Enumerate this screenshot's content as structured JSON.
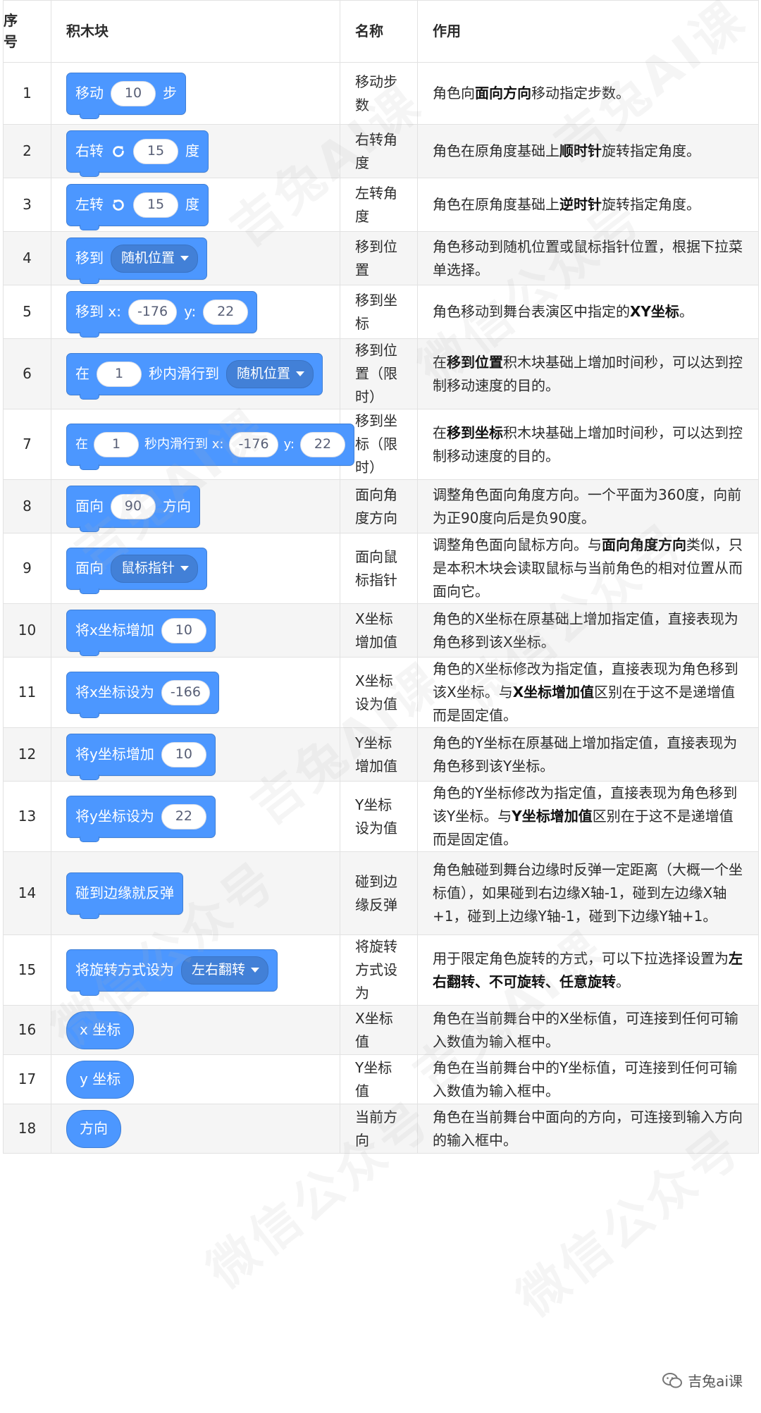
{
  "headers": {
    "index": "序号",
    "block": "积木块",
    "name": "名称",
    "desc": "作用"
  },
  "rows": [
    {
      "idx": "1",
      "block_parts": [
        "移动",
        "10",
        "步"
      ],
      "name": "移动步\n数",
      "desc": [
        {
          "t": "角色向"
        },
        {
          "t": "面向方向",
          "b": true
        },
        {
          "t": "移动指定步数。"
        }
      ]
    },
    {
      "idx": "2",
      "block_parts": [
        "右转",
        "15",
        "度"
      ],
      "name": "右转角\n度",
      "desc": [
        {
          "t": "角色在原角度基础上"
        },
        {
          "t": "顺时针",
          "b": true
        },
        {
          "t": "旋转指定角度。"
        }
      ]
    },
    {
      "idx": "3",
      "block_parts": [
        "左转",
        "15",
        "度"
      ],
      "name": "左转角\n度",
      "desc": [
        {
          "t": "角色在原角度基础上"
        },
        {
          "t": "逆时针",
          "b": true
        },
        {
          "t": "旋转指定角度。"
        }
      ]
    },
    {
      "idx": "4",
      "block_parts": [
        "移到",
        "随机位置"
      ],
      "name": "移到位\n置",
      "desc": [
        {
          "t": "角色移动到随机位置或鼠标指针位置，根据下拉菜单选择。"
        }
      ]
    },
    {
      "idx": "5",
      "block_parts": [
        "移到 x:",
        "-176",
        "y:",
        "22"
      ],
      "name": "移到坐\n标",
      "desc": [
        {
          "t": "角色移动到舞台表演区中指定的"
        },
        {
          "t": "XY坐标",
          "b": true
        },
        {
          "t": "。"
        }
      ]
    },
    {
      "idx": "6",
      "block_parts": [
        "在",
        "1",
        "秒内滑行到",
        "随机位置"
      ],
      "name": "移到位\n置（限\n时）",
      "desc": [
        {
          "t": "在"
        },
        {
          "t": "移到位置",
          "b": true
        },
        {
          "t": "积木块基础上增加时间秒，可以达到控制移动速度的目的。"
        }
      ]
    },
    {
      "idx": "7",
      "block_parts": [
        "在",
        "1",
        "秒内滑行到 x:",
        "-176",
        "y:",
        "22"
      ],
      "name": "移到坐\n标（限\n时）",
      "desc": [
        {
          "t": "在"
        },
        {
          "t": "移到坐标",
          "b": true
        },
        {
          "t": "积木块基础上增加时间秒，可以达到控制移动速度的目的。"
        }
      ]
    },
    {
      "idx": "8",
      "block_parts": [
        "面向",
        "90",
        "方向"
      ],
      "name": "面向角\n度方向",
      "desc": [
        {
          "t": "调整角色面向角度方向。一个平面为360度，向前为正90度向后是负90度。"
        }
      ]
    },
    {
      "idx": "9",
      "block_parts": [
        "面向",
        "鼠标指针"
      ],
      "name": "面向鼠\n标指针",
      "desc": [
        {
          "t": "调整角色面向鼠标方向。与"
        },
        {
          "t": "面向角度方向",
          "b": true
        },
        {
          "t": "类似，只是本积木块会读取鼠标与当前角色的相对位置从而面向它。"
        }
      ]
    },
    {
      "idx": "10",
      "block_parts": [
        "将x坐标增加",
        "10"
      ],
      "name": "X坐标\n增加值",
      "desc": [
        {
          "t": "角色的X坐标在原基础上增加指定值，直接表现为角色移到该X坐标。"
        }
      ]
    },
    {
      "idx": "11",
      "block_parts": [
        "将x坐标设为",
        "-166"
      ],
      "name": "X坐标\n设为值",
      "desc": [
        {
          "t": "角色的X坐标修改为指定值，直接表现为角色移到该X坐标。与"
        },
        {
          "t": "X坐标增加值",
          "b": true
        },
        {
          "t": "区别在于这不是递增值而是固定值。"
        }
      ]
    },
    {
      "idx": "12",
      "block_parts": [
        "将y坐标增加",
        "10"
      ],
      "name": "Y坐标\n增加值",
      "desc": [
        {
          "t": "角色的Y坐标在原基础上增加指定值，直接表现为角色移到该Y坐标。"
        }
      ]
    },
    {
      "idx": "13",
      "block_parts": [
        "将y坐标设为",
        "22"
      ],
      "name": "Y坐标\n设为值",
      "desc": [
        {
          "t": "角色的Y坐标修改为指定值，直接表现为角色移到该Y坐标。与"
        },
        {
          "t": "Y坐标增加值",
          "b": true
        },
        {
          "t": "区别在于这不是递增值而是固定值。"
        }
      ]
    },
    {
      "idx": "14",
      "block_parts": [
        "碰到边缘就反弹"
      ],
      "name": "碰到边\n缘反弹",
      "desc": [
        {
          "t": "角色触碰到舞台边缘时反弹一定距离（大概一个坐标值），如果碰到右边缘X轴-1，碰到左边缘X轴+1，碰到上边缘Y轴-1，碰到下边缘Y轴+1。"
        }
      ]
    },
    {
      "idx": "15",
      "block_parts": [
        "将旋转方式设为",
        "左右翻转"
      ],
      "name": "将旋转\n方式设\n为",
      "desc": [
        {
          "t": "用于限定角色旋转的方式，可以下拉选择设置为"
        },
        {
          "t": "左右翻转、不可旋转、任意旋转",
          "b": true
        },
        {
          "t": "。"
        }
      ]
    },
    {
      "idx": "16",
      "block_parts": [
        "x 坐标"
      ],
      "name": "X坐标\n值",
      "desc": [
        {
          "t": "角色在当前舞台中的X坐标值，可连接到任何可输入数值为输入框中。"
        }
      ]
    },
    {
      "idx": "17",
      "block_parts": [
        "y 坐标"
      ],
      "name": "Y坐标\n值",
      "desc": [
        {
          "t": "角色在当前舞台中的Y坐标值，可连接到任何可输入数值为输入框中。"
        }
      ]
    },
    {
      "idx": "18",
      "block_parts": [
        "方向"
      ],
      "name": "当前方\n向",
      "desc": [
        {
          "t": "角色在当前舞台中面向的方向，可连接到输入方向的输入框中。"
        }
      ]
    }
  ],
  "watermark": {
    "channel_label": "微信公众号",
    "brand": "吉兔AI课",
    "corner_label": "吉兔ai课"
  },
  "colors": {
    "block_blue": "#4c97ff",
    "dropdown_blue": "#4280d7",
    "row_alt": "#f5f5f5",
    "border": "#e2e2e2"
  }
}
